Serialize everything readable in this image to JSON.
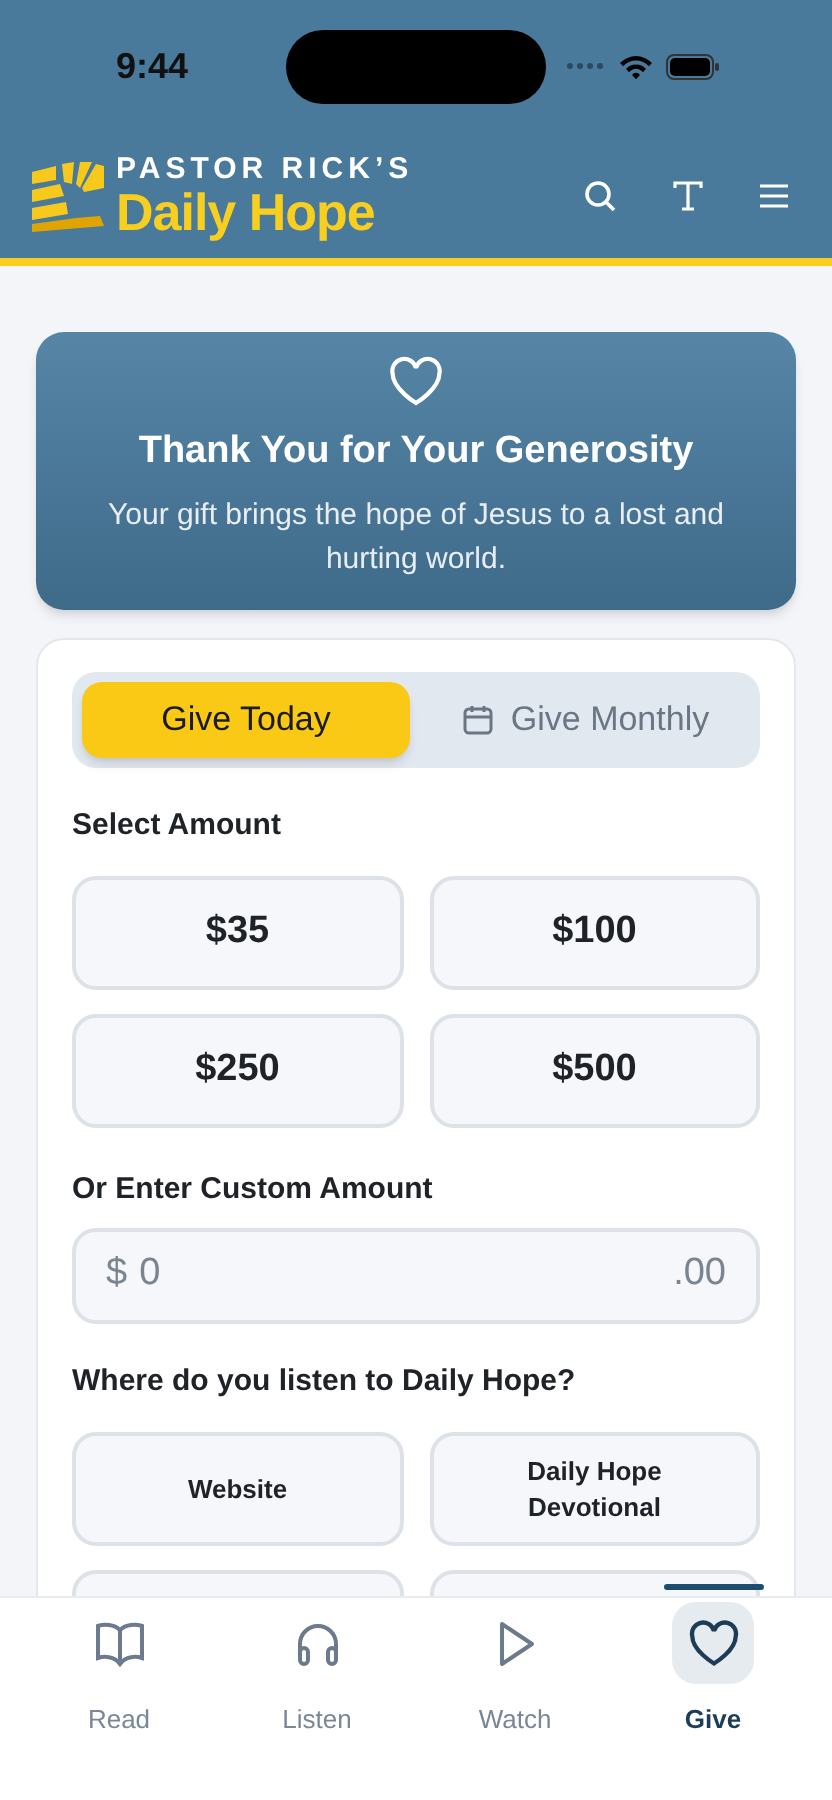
{
  "status_bar": {
    "time": "9:44"
  },
  "header": {
    "logo_top": "PASTOR RICK’S",
    "logo_bottom": "Daily Hope"
  },
  "hero": {
    "title": "Thank You for Your Generosity",
    "text": "Your gift brings the hope of Jesus to a lost and hurting world."
  },
  "give_tabs": [
    {
      "label": "Give Today",
      "selected": true
    },
    {
      "label": "Give Monthly",
      "selected": false
    }
  ],
  "amount_label": "Select Amount",
  "amounts": [
    {
      "label": "$35",
      "selected": false
    },
    {
      "label": "$100",
      "selected": false
    },
    {
      "label": "$250",
      "selected": false
    },
    {
      "label": "$500",
      "selected": false
    }
  ],
  "custom_label": "Or Enter Custom Amount",
  "custom_field": {
    "prefix": "$",
    "placeholder": "0",
    "suffix": ".00"
  },
  "listen_label": "Where do you listen to Daily Hope?",
  "listen_options": [
    {
      "label": "Website",
      "selected": false
    },
    {
      "label": "Daily Hope Devotional",
      "selected": false
    }
  ],
  "bottom_nav": [
    {
      "label": "Read",
      "selected": false
    },
    {
      "label": "Listen",
      "selected": false
    },
    {
      "label": "Watch",
      "selected": false
    },
    {
      "label": "Give",
      "selected": true
    }
  ]
}
